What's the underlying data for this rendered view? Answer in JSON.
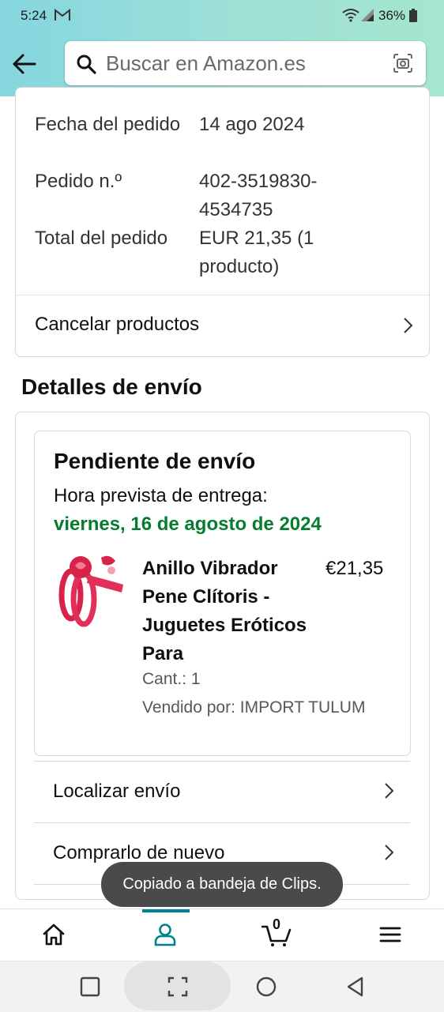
{
  "status_bar": {
    "time": "5:24",
    "battery": "36%"
  },
  "search": {
    "placeholder": "Buscar en Amazon.es"
  },
  "order_summary": {
    "rows": [
      {
        "label": "Fecha del pedido",
        "value": "14 ago 2024"
      },
      {
        "label": "Pedido n.º",
        "value": "402-3519830-4534735"
      },
      {
        "label": "Total del pedido",
        "value": "EUR 21,35 (1 producto)"
      }
    ],
    "cancel_label": "Cancelar productos"
  },
  "shipping": {
    "section_title": "Detalles de envío",
    "status_title": "Pendiente de envío",
    "eta_label": "Hora prevista de entrega:",
    "eta_date": "viernes, 16 de agosto de 2024",
    "product": {
      "title": "Anillo Vibrador Pene Clítoris - Juguetes Eróticos Para",
      "price": "€21,35",
      "quantity": "Cant.: 1",
      "seller": "Vendido por: IMPORT TULUM"
    },
    "actions": [
      "Localizar envío",
      "Comprarlo de nuevo"
    ]
  },
  "toast": "Copiado a bandeja de Clips.",
  "bottom_nav": {
    "cart_count": "0",
    "active": "account"
  },
  "colors": {
    "accent": "#00838f",
    "eta_green": "#067d2e",
    "header_gradient": "#85d6df"
  }
}
